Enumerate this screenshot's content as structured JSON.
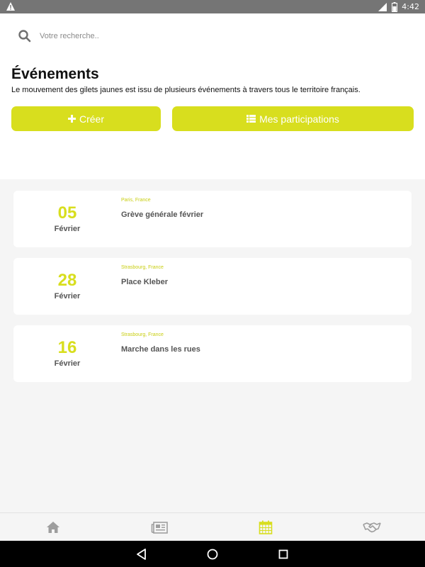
{
  "status_bar": {
    "time": "4:42",
    "network": "4G",
    "icons": [
      "warning-icon",
      "signal-icon",
      "battery-icon"
    ]
  },
  "search": {
    "placeholder": "Votre recherche.."
  },
  "header": {
    "title": "Événements",
    "description": "Le mouvement des gilets jaunes est issu de plusieurs événements à travers tous le territoire français."
  },
  "actions": {
    "create_label": "Créer",
    "participations_label": "Mes participations"
  },
  "events": [
    {
      "day": "05",
      "month": "Février",
      "location": "Paris, France",
      "title": "Grève générale février"
    },
    {
      "day": "28",
      "month": "Février",
      "location": "Strasbourg, France",
      "title": "Place Kleber"
    },
    {
      "day": "16",
      "month": "Février",
      "location": "Strasbourg, France",
      "title": "Marche dans les rues"
    }
  ],
  "bottom_nav": {
    "items": [
      "home-icon",
      "newspaper-icon",
      "calendar-icon",
      "handshake-icon"
    ],
    "active": "calendar-icon"
  },
  "colors": {
    "accent": "#d8de1e",
    "status_bar": "#757575",
    "list_background": "#f5f5f5",
    "nav_inactive": "#9e9e9e"
  }
}
